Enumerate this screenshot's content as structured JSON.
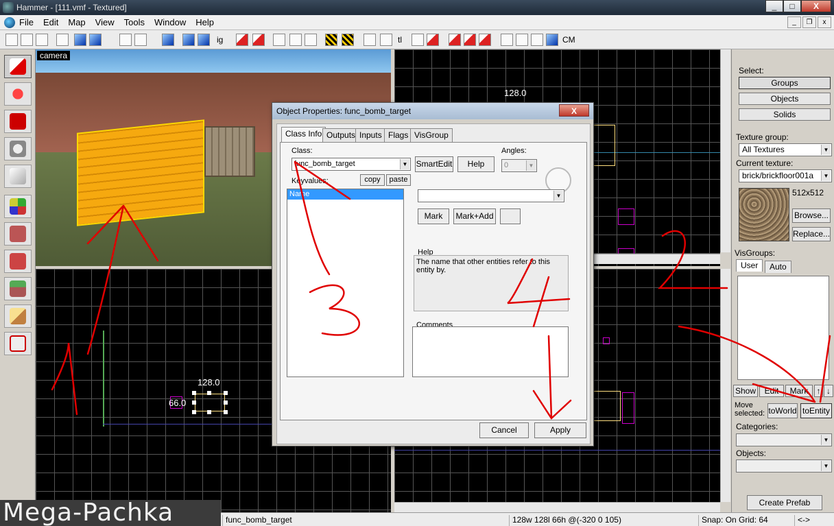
{
  "window": {
    "title": "Hammer - [111.vmf - Textured]",
    "buttons": {
      "minimize": "_",
      "maximize": "□",
      "close": "X"
    }
  },
  "menu": {
    "items": [
      "File",
      "Edit",
      "Map",
      "View",
      "Tools",
      "Window",
      "Help"
    ],
    "mdi": {
      "minimize": "_",
      "restore": "❐",
      "close": "x"
    }
  },
  "toolbar": {
    "text_buttons": {
      "ig": "ig",
      "tl": "tl",
      "cm": "CM"
    }
  },
  "viewports": {
    "camera_label": "camera",
    "top_right_dimension": "128.0",
    "bottom_left_width": "128.0",
    "bottom_left_height": "66.0"
  },
  "dialog": {
    "title": "Object Properties: func_bomb_target",
    "close": "X",
    "tabs": [
      "Class Info",
      "Outputs",
      "Inputs",
      "Flags",
      "VisGroup"
    ],
    "class_label": "Class:",
    "class_value": "func_bomb_target",
    "smartedit": "SmartEdit",
    "help_button": "Help",
    "angles_label": "Angles:",
    "angles_value": "0",
    "keyvalues_label": "Keyvalues:",
    "copy": "copy",
    "paste": "paste",
    "keyvalue_selected": "Name",
    "mark": "Mark",
    "mark_add": "Mark+Add",
    "help_label": "Help",
    "help_text": "The name that other entities refer to this entity by.",
    "comments_label": "Comments",
    "cancel": "Cancel",
    "apply": "Apply"
  },
  "rightpanel": {
    "select_label": "Select:",
    "groups": "Groups",
    "objects": "Objects",
    "solids": "Solids",
    "texture_group_label": "Texture group:",
    "texture_group_value": "All Textures",
    "current_texture_label": "Current texture:",
    "current_texture_value": "brick/brickfloor001a",
    "texture_size": "512x512",
    "browse": "Browse...",
    "replace": "Replace...",
    "visgroups_label": "VisGroups:",
    "tab_user": "User",
    "tab_auto": "Auto",
    "show": "Show",
    "edit": "Edit",
    "mark": "Mark",
    "up": "↑",
    "down": "↓",
    "move_selected": "Move selected:",
    "to_world": "toWorld",
    "to_entity": "toEntity",
    "categories_label": "Categories:",
    "objects_label": "Objects:",
    "create_prefab": "Create Prefab"
  },
  "statusbar": {
    "entity": "func_bomb_target",
    "dimensions": "128w 128l 66h @(-320 0 105)",
    "snap": "Snap: On Grid: 64",
    "arrows": "<->"
  },
  "watermark": "Mega-Pachka",
  "annotations": [
    "1",
    "2",
    "3",
    "4"
  ],
  "colors": {
    "annotation_red": "#e00000",
    "selection_yellow": "#ffd800",
    "list_highlight": "#3399ff"
  }
}
